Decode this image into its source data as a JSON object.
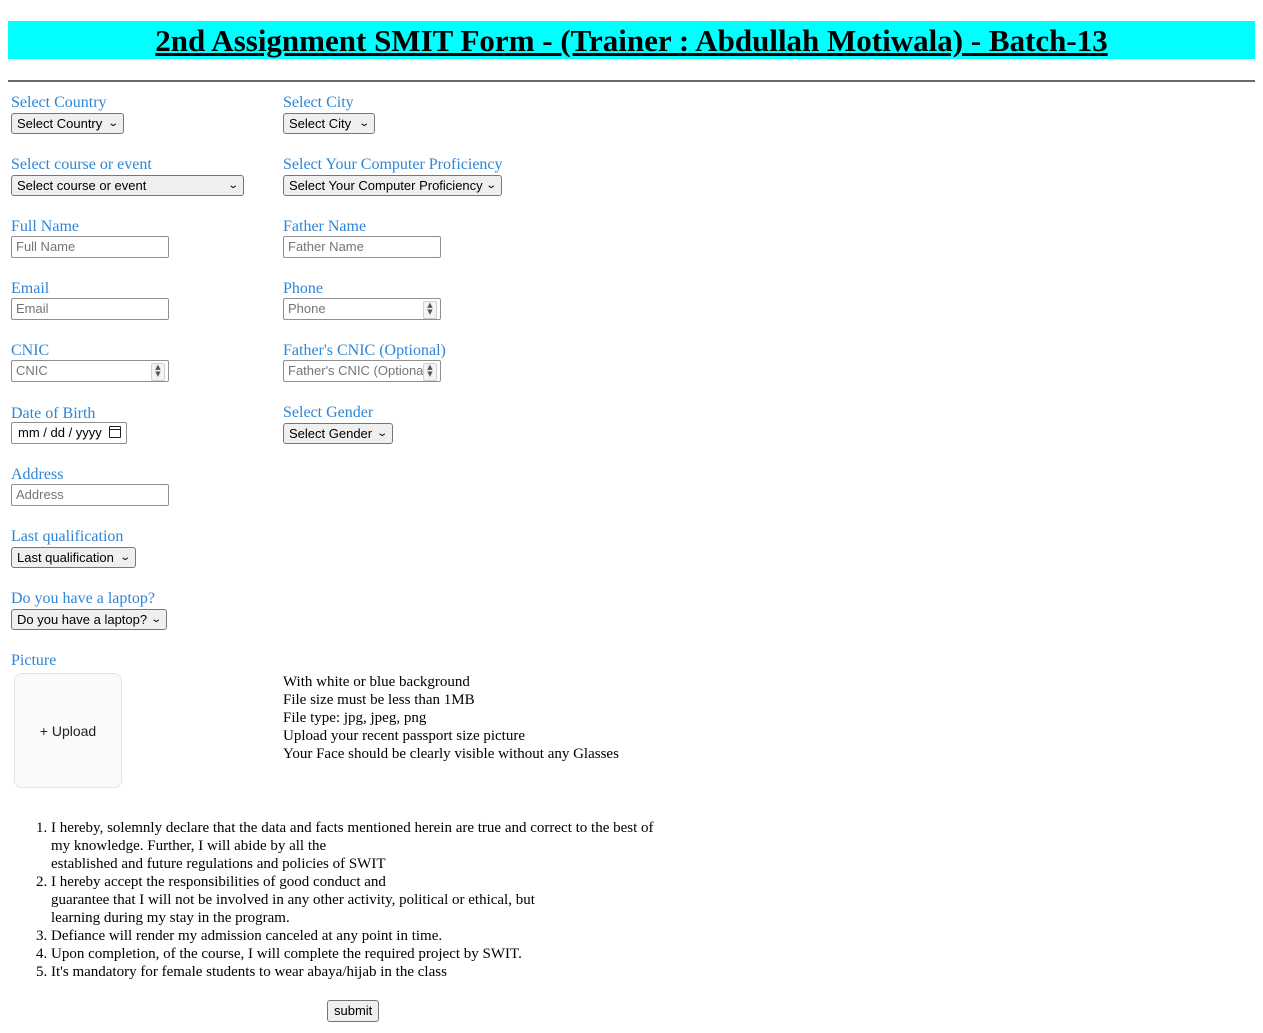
{
  "header": {
    "title": "2nd Assignment SMIT Form - (Trainer : Abdullah Motiwala) - Batch-13"
  },
  "form": {
    "country": {
      "label": "Select Country",
      "value": "Select Country"
    },
    "city": {
      "label": "Select City",
      "value": "Select City"
    },
    "course": {
      "label": "Select course or event",
      "value": "Select course or event"
    },
    "proficiency": {
      "label": "Select Your Computer Proficiency",
      "value": "Select Your Computer Proficiency"
    },
    "full_name": {
      "label": "Full Name",
      "placeholder": "Full Name"
    },
    "father_name": {
      "label": "Father Name",
      "placeholder": "Father Name"
    },
    "email": {
      "label": "Email",
      "placeholder": "Email"
    },
    "phone": {
      "label": "Phone",
      "placeholder": "Phone"
    },
    "cnic": {
      "label": "CNIC",
      "placeholder": "CNIC"
    },
    "father_cnic": {
      "label": "Father's CNIC (Optional)",
      "placeholder": "Father's CNIC (Optional"
    },
    "dob": {
      "label": "Date of Birth",
      "value": "mm / dd / yyyy"
    },
    "gender": {
      "label": "Select Gender",
      "value": "Select Gender"
    },
    "address": {
      "label": "Address",
      "placeholder": "Address"
    },
    "qualification": {
      "label": "Last qualification",
      "value": "Last qualification"
    },
    "laptop": {
      "label": "Do you have a laptop?",
      "value": "Do you have a laptop?"
    },
    "picture": {
      "label": "Picture",
      "upload_label": "+ Upload",
      "instructions": [
        "With white or blue background",
        "File size must be less than 1MB",
        "File type: jpg, jpeg, png",
        "Upload your recent passport size picture",
        "Your Face should be clearly visible without any Glasses"
      ]
    }
  },
  "declarations": [
    {
      "lines": [
        "I hereby, solemnly declare that the data and facts mentioned herein are true and correct to the best of",
        "my knowledge. Further, I will abide by all the",
        "established and future regulations and policies of SWIT"
      ]
    },
    {
      "lines": [
        "I hereby accept the responsibilities of good conduct and",
        "guarantee that I will not be involved in any other activity, political or ethical, but",
        "learning during my stay in the program."
      ]
    },
    {
      "lines": [
        "Defiance will render my admission canceled at any point in time."
      ]
    },
    {
      "lines": [
        "Upon completion, of the course, I will complete the required project by SWIT."
      ]
    },
    {
      "lines": [
        "It's mandatory for female students to wear abaya/hijab in the class"
      ]
    }
  ],
  "submit_label": "submit"
}
